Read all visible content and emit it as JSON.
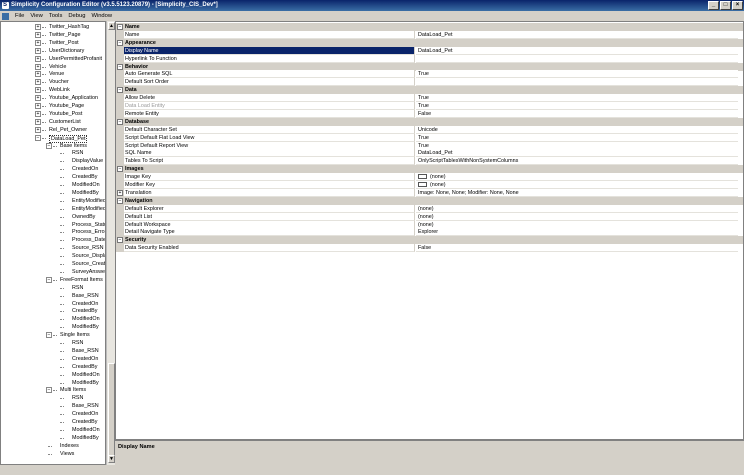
{
  "window": {
    "title": "Simplicity Configuration Editor (v3.5.5123.20879) - [Simplicity_CIS_Dev*]",
    "controls": [
      "_",
      "□",
      "×"
    ]
  },
  "menu": [
    "File",
    "View",
    "Tools",
    "Debug",
    "Window"
  ],
  "tree": {
    "items": [
      {
        "level": 0,
        "exp": "+",
        "label": "Twitter_HashTag"
      },
      {
        "level": 0,
        "exp": "+",
        "label": "Twitter_Page"
      },
      {
        "level": 0,
        "exp": "+",
        "label": "Twitter_Post"
      },
      {
        "level": 0,
        "exp": "+",
        "label": "UserDictionary"
      },
      {
        "level": 0,
        "exp": "+",
        "label": "UserPermittedProfanit"
      },
      {
        "level": 0,
        "exp": "+",
        "label": "Vehicle"
      },
      {
        "level": 0,
        "exp": "+",
        "label": "Venue"
      },
      {
        "level": 0,
        "exp": "+",
        "label": "Voucher"
      },
      {
        "level": 0,
        "exp": "+",
        "label": "WebLink"
      },
      {
        "level": 0,
        "exp": "+",
        "label": "Youtube_Application"
      },
      {
        "level": 0,
        "exp": "+",
        "label": "Youtube_Page"
      },
      {
        "level": 0,
        "exp": "+",
        "label": "Youtube_Post"
      },
      {
        "level": 0,
        "exp": "+",
        "label": "CustomerList"
      },
      {
        "level": 0,
        "exp": "+",
        "label": "Rel_Pet_Owner"
      },
      {
        "level": 0,
        "exp": "−",
        "label": "DataLoad_Pet",
        "selected": true
      },
      {
        "level": 1,
        "exp": "−",
        "label": "Base Items"
      },
      {
        "level": 2,
        "label": "RSN"
      },
      {
        "level": 2,
        "label": "DisplayValue"
      },
      {
        "level": 2,
        "label": "CreatedOn"
      },
      {
        "level": 2,
        "label": "CreatedBy"
      },
      {
        "level": 2,
        "label": "ModifiedOn"
      },
      {
        "level": 2,
        "label": "ModifiedBy"
      },
      {
        "level": 2,
        "label": "EntityModified"
      },
      {
        "level": 2,
        "label": "EntityModified"
      },
      {
        "level": 2,
        "label": "OwnedBy"
      },
      {
        "level": 2,
        "label": "Process_Statu"
      },
      {
        "level": 2,
        "label": "Process_Error"
      },
      {
        "level": 2,
        "label": "Process_Date"
      },
      {
        "level": 2,
        "label": "Source_RSN"
      },
      {
        "level": 2,
        "label": "Source_Displa"
      },
      {
        "level": 2,
        "label": "Source_Creat"
      },
      {
        "level": 2,
        "label": "SurveyAnswe"
      },
      {
        "level": 1,
        "exp": "−",
        "label": "FreeFormat Items"
      },
      {
        "level": 2,
        "label": "RSN"
      },
      {
        "level": 2,
        "label": "Base_RSN"
      },
      {
        "level": 2,
        "label": "CreatedOn"
      },
      {
        "level": 2,
        "label": "CreatedBy"
      },
      {
        "level": 2,
        "label": "ModifiedOn"
      },
      {
        "level": 2,
        "label": "ModifiedBy"
      },
      {
        "level": 1,
        "exp": "−",
        "label": "Single Items"
      },
      {
        "level": 2,
        "label": "RSN"
      },
      {
        "level": 2,
        "label": "Base_RSN"
      },
      {
        "level": 2,
        "label": "CreatedOn"
      },
      {
        "level": 2,
        "label": "CreatedBy"
      },
      {
        "level": 2,
        "label": "ModifiedOn"
      },
      {
        "level": 2,
        "label": "ModifiedBy"
      },
      {
        "level": 1,
        "exp": "−",
        "label": "Multi Items"
      },
      {
        "level": 2,
        "label": "RSN"
      },
      {
        "level": 2,
        "label": "Base_RSN"
      },
      {
        "level": 2,
        "label": "CreatedOn"
      },
      {
        "level": 2,
        "label": "CreatedBy"
      },
      {
        "level": 2,
        "label": "ModifiedOn"
      },
      {
        "level": 2,
        "label": "ModifiedBy"
      },
      {
        "level": 1,
        "label": "Indexes"
      },
      {
        "level": 1,
        "label": "Views"
      }
    ]
  },
  "properties": [
    {
      "type": "cat",
      "label": "Name"
    },
    {
      "name": "Name",
      "value": "DataLoad_Pet"
    },
    {
      "type": "cat",
      "label": "Appearance"
    },
    {
      "name": "Display Name",
      "value": "DataLoad_Pet",
      "selected": true
    },
    {
      "name": "Hyperlink To Function",
      "value": ""
    },
    {
      "type": "cat",
      "label": "Behavior"
    },
    {
      "name": "Auto Generate SQL",
      "value": "True"
    },
    {
      "name": "Default Sort Order",
      "value": ""
    },
    {
      "type": "cat",
      "label": "Data"
    },
    {
      "name": "Allow Delete",
      "value": "True"
    },
    {
      "name": "Data Load Entity",
      "value": "True",
      "disabled": true
    },
    {
      "name": "Remote Entity",
      "value": "False"
    },
    {
      "type": "cat",
      "label": "Database"
    },
    {
      "name": "Default Character Set",
      "value": "Unicode"
    },
    {
      "name": "Script Default Flat Load View",
      "value": "True"
    },
    {
      "name": "Script Default Report View",
      "value": "True"
    },
    {
      "name": "SQL Name",
      "value": "DataLoad_Pet"
    },
    {
      "name": "Tables To Script",
      "value": "OnlyScriptTablesWithNonSystemColumns"
    },
    {
      "type": "cat",
      "label": "Images"
    },
    {
      "name": "Image Key",
      "value": "(none)",
      "swatch": true
    },
    {
      "name": "Modifier Key",
      "value": "(none)",
      "swatch": true
    },
    {
      "name": "Translation",
      "value": "Image: None, None; Modifier: None, None",
      "expander": "+"
    },
    {
      "type": "cat",
      "label": "Navigation"
    },
    {
      "name": "Default Explorer",
      "value": "(none)"
    },
    {
      "name": "Default List",
      "value": "(none)"
    },
    {
      "name": "Default Workspace",
      "value": "(none)"
    },
    {
      "name": "Detail Navigate Type",
      "value": "Explorer"
    },
    {
      "type": "cat",
      "label": "Security"
    },
    {
      "name": "Data Security Enabled",
      "value": "False"
    }
  ],
  "description": {
    "title": "Display Name"
  }
}
